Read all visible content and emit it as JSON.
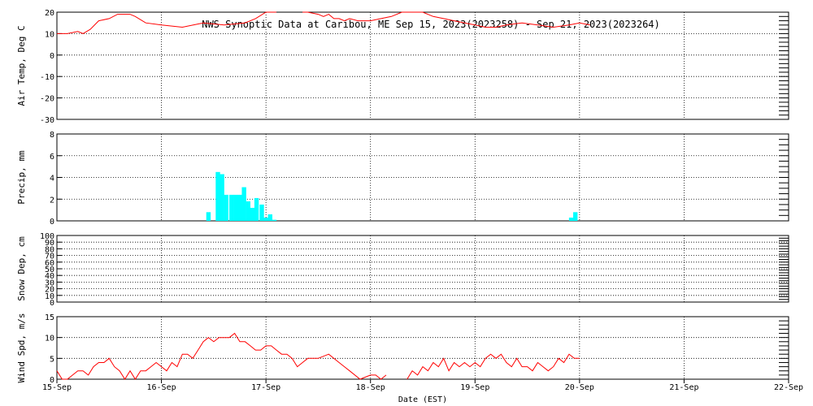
{
  "chart_data": {
    "type": "multi-panel",
    "title": "NWS Synoptic Data at Caribou, ME   Sep 15, 2023(2023258) - Sep 21, 2023(2023264)",
    "xlabel": "Date (EST)",
    "x_ticks": [
      "15-Sep",
      "16-Sep",
      "17-Sep",
      "18-Sep",
      "19-Sep",
      "20-Sep",
      "21-Sep",
      "22-Sep"
    ],
    "x_range_days": [
      0,
      7
    ],
    "panels": [
      {
        "type": "line",
        "ylabel": "Air Temp, Deg C",
        "ylim": [
          -30,
          20
        ],
        "yticks": [
          20,
          10,
          0,
          -10,
          -20,
          -30
        ],
        "color": "#ff0000",
        "x": [
          0,
          0.1,
          0.2,
          0.25,
          0.32,
          0.4,
          0.5,
          0.58,
          0.65,
          0.7,
          0.75,
          0.85,
          1.0,
          1.2,
          1.4,
          1.6,
          1.8,
          1.9,
          2.0,
          2.1
        ],
        "y": [
          10,
          10,
          11,
          10,
          12,
          16,
          17,
          19,
          19,
          19,
          18,
          15,
          14,
          13,
          15,
          14,
          15,
          17,
          20,
          22
        ]
      },
      {
        "type": "line",
        "ylabel": "",
        "ylim": [
          -30,
          20
        ],
        "color": "#ff0000",
        "x": [
          2.35,
          2.4,
          2.5,
          2.55,
          2.6,
          2.65,
          2.7,
          2.75,
          2.8,
          2.88,
          2.95,
          3.0,
          3.1,
          3.2,
          3.3,
          3.4,
          3.5,
          3.6,
          3.7,
          3.8,
          3.9,
          4.0,
          4.1,
          4.2,
          4.3,
          4.45,
          4.6,
          4.75,
          4.9,
          5.0,
          5.1
        ],
        "y": [
          21,
          20,
          19,
          18,
          19,
          17,
          17,
          16,
          17,
          16,
          16,
          16,
          17,
          18,
          21,
          21,
          20,
          18,
          17,
          16,
          15,
          14,
          13,
          13,
          14,
          15,
          14,
          13,
          14,
          15,
          14
        ]
      },
      {
        "type": "bar",
        "ylabel": "Precip, mm",
        "ylim": [
          0,
          8
        ],
        "yticks": [
          8,
          6,
          4,
          2,
          0
        ],
        "color": "#00ffff",
        "bar_width": 0.042,
        "x": [
          1.45,
          1.54,
          1.58,
          1.62,
          1.67,
          1.71,
          1.75,
          1.79,
          1.83,
          1.87,
          1.91,
          1.96,
          2.0,
          2.04,
          2.08,
          2.12,
          4.92,
          4.96
        ],
        "y": [
          0.8,
          4.5,
          4.3,
          2.4,
          2.4,
          2.4,
          2.4,
          3.1,
          1.8,
          1.2,
          2.1,
          1.5,
          0.3,
          0.6,
          0.1,
          0.0,
          0.3,
          0.8
        ]
      },
      {
        "type": "line",
        "ylabel": "Snow Dep, cm",
        "ylim": [
          0,
          100
        ],
        "yticks": [
          100,
          90,
          80,
          70,
          60,
          50,
          40,
          30,
          20,
          10,
          0
        ],
        "color": "#ff0000",
        "x": [],
        "y": []
      },
      {
        "type": "line",
        "ylabel": "Wind Spd, m/s",
        "ylim": [
          0,
          15
        ],
        "yticks": [
          15,
          10,
          5,
          0
        ],
        "color": "#ff0000",
        "x": [
          0,
          0.05,
          0.1,
          0.15,
          0.2,
          0.25,
          0.3,
          0.35,
          0.4,
          0.45,
          0.5,
          0.55,
          0.6,
          0.65,
          0.7,
          0.75,
          0.8,
          0.85,
          0.9,
          0.95,
          1.0,
          1.05,
          1.1,
          1.15,
          1.2,
          1.25,
          1.3,
          1.35,
          1.4,
          1.45,
          1.5,
          1.55,
          1.6,
          1.65,
          1.7,
          1.75,
          1.8,
          1.85,
          1.9,
          1.95,
          2.0,
          2.05,
          2.1,
          2.15,
          2.2,
          2.25,
          2.3,
          2.35,
          2.4,
          2.5,
          2.6,
          2.7,
          2.75,
          2.8,
          2.9,
          3.0,
          3.05,
          3.1,
          3.15
        ],
        "y": [
          2,
          0,
          0,
          1,
          2,
          2,
          1,
          3,
          4,
          4,
          5,
          3,
          2,
          0,
          2,
          0,
          2,
          2,
          3,
          4,
          3,
          2,
          4,
          3,
          6,
          6,
          5,
          7,
          9,
          10,
          9,
          10,
          10,
          10,
          11,
          9,
          9,
          8,
          7,
          7,
          8,
          8,
          7,
          6,
          6,
          5,
          3,
          4,
          5,
          5,
          6,
          4,
          3,
          2,
          0,
          1,
          1,
          0,
          1
        ]
      },
      {
        "type": "line",
        "ylabel": "",
        "ylim": [
          0,
          15
        ],
        "color": "#ff0000",
        "x": [
          3.35,
          3.4,
          3.45,
          3.5,
          3.55,
          3.6,
          3.65,
          3.7,
          3.75,
          3.8,
          3.85,
          3.9,
          3.95,
          4.0,
          4.05,
          4.1,
          4.15,
          4.2,
          4.25,
          4.3,
          4.35,
          4.4,
          4.45,
          4.5,
          4.55,
          4.6,
          4.65,
          4.7,
          4.75,
          4.8,
          4.85,
          4.9,
          4.95,
          5.0
        ],
        "y": [
          0,
          2,
          1,
          3,
          2,
          4,
          3,
          5,
          2,
          4,
          3,
          4,
          3,
          4,
          3,
          5,
          6,
          5,
          6,
          4,
          3,
          5,
          3,
          3,
          2,
          4,
          3,
          2,
          3,
          5,
          4,
          6,
          5,
          5
        ]
      }
    ]
  }
}
